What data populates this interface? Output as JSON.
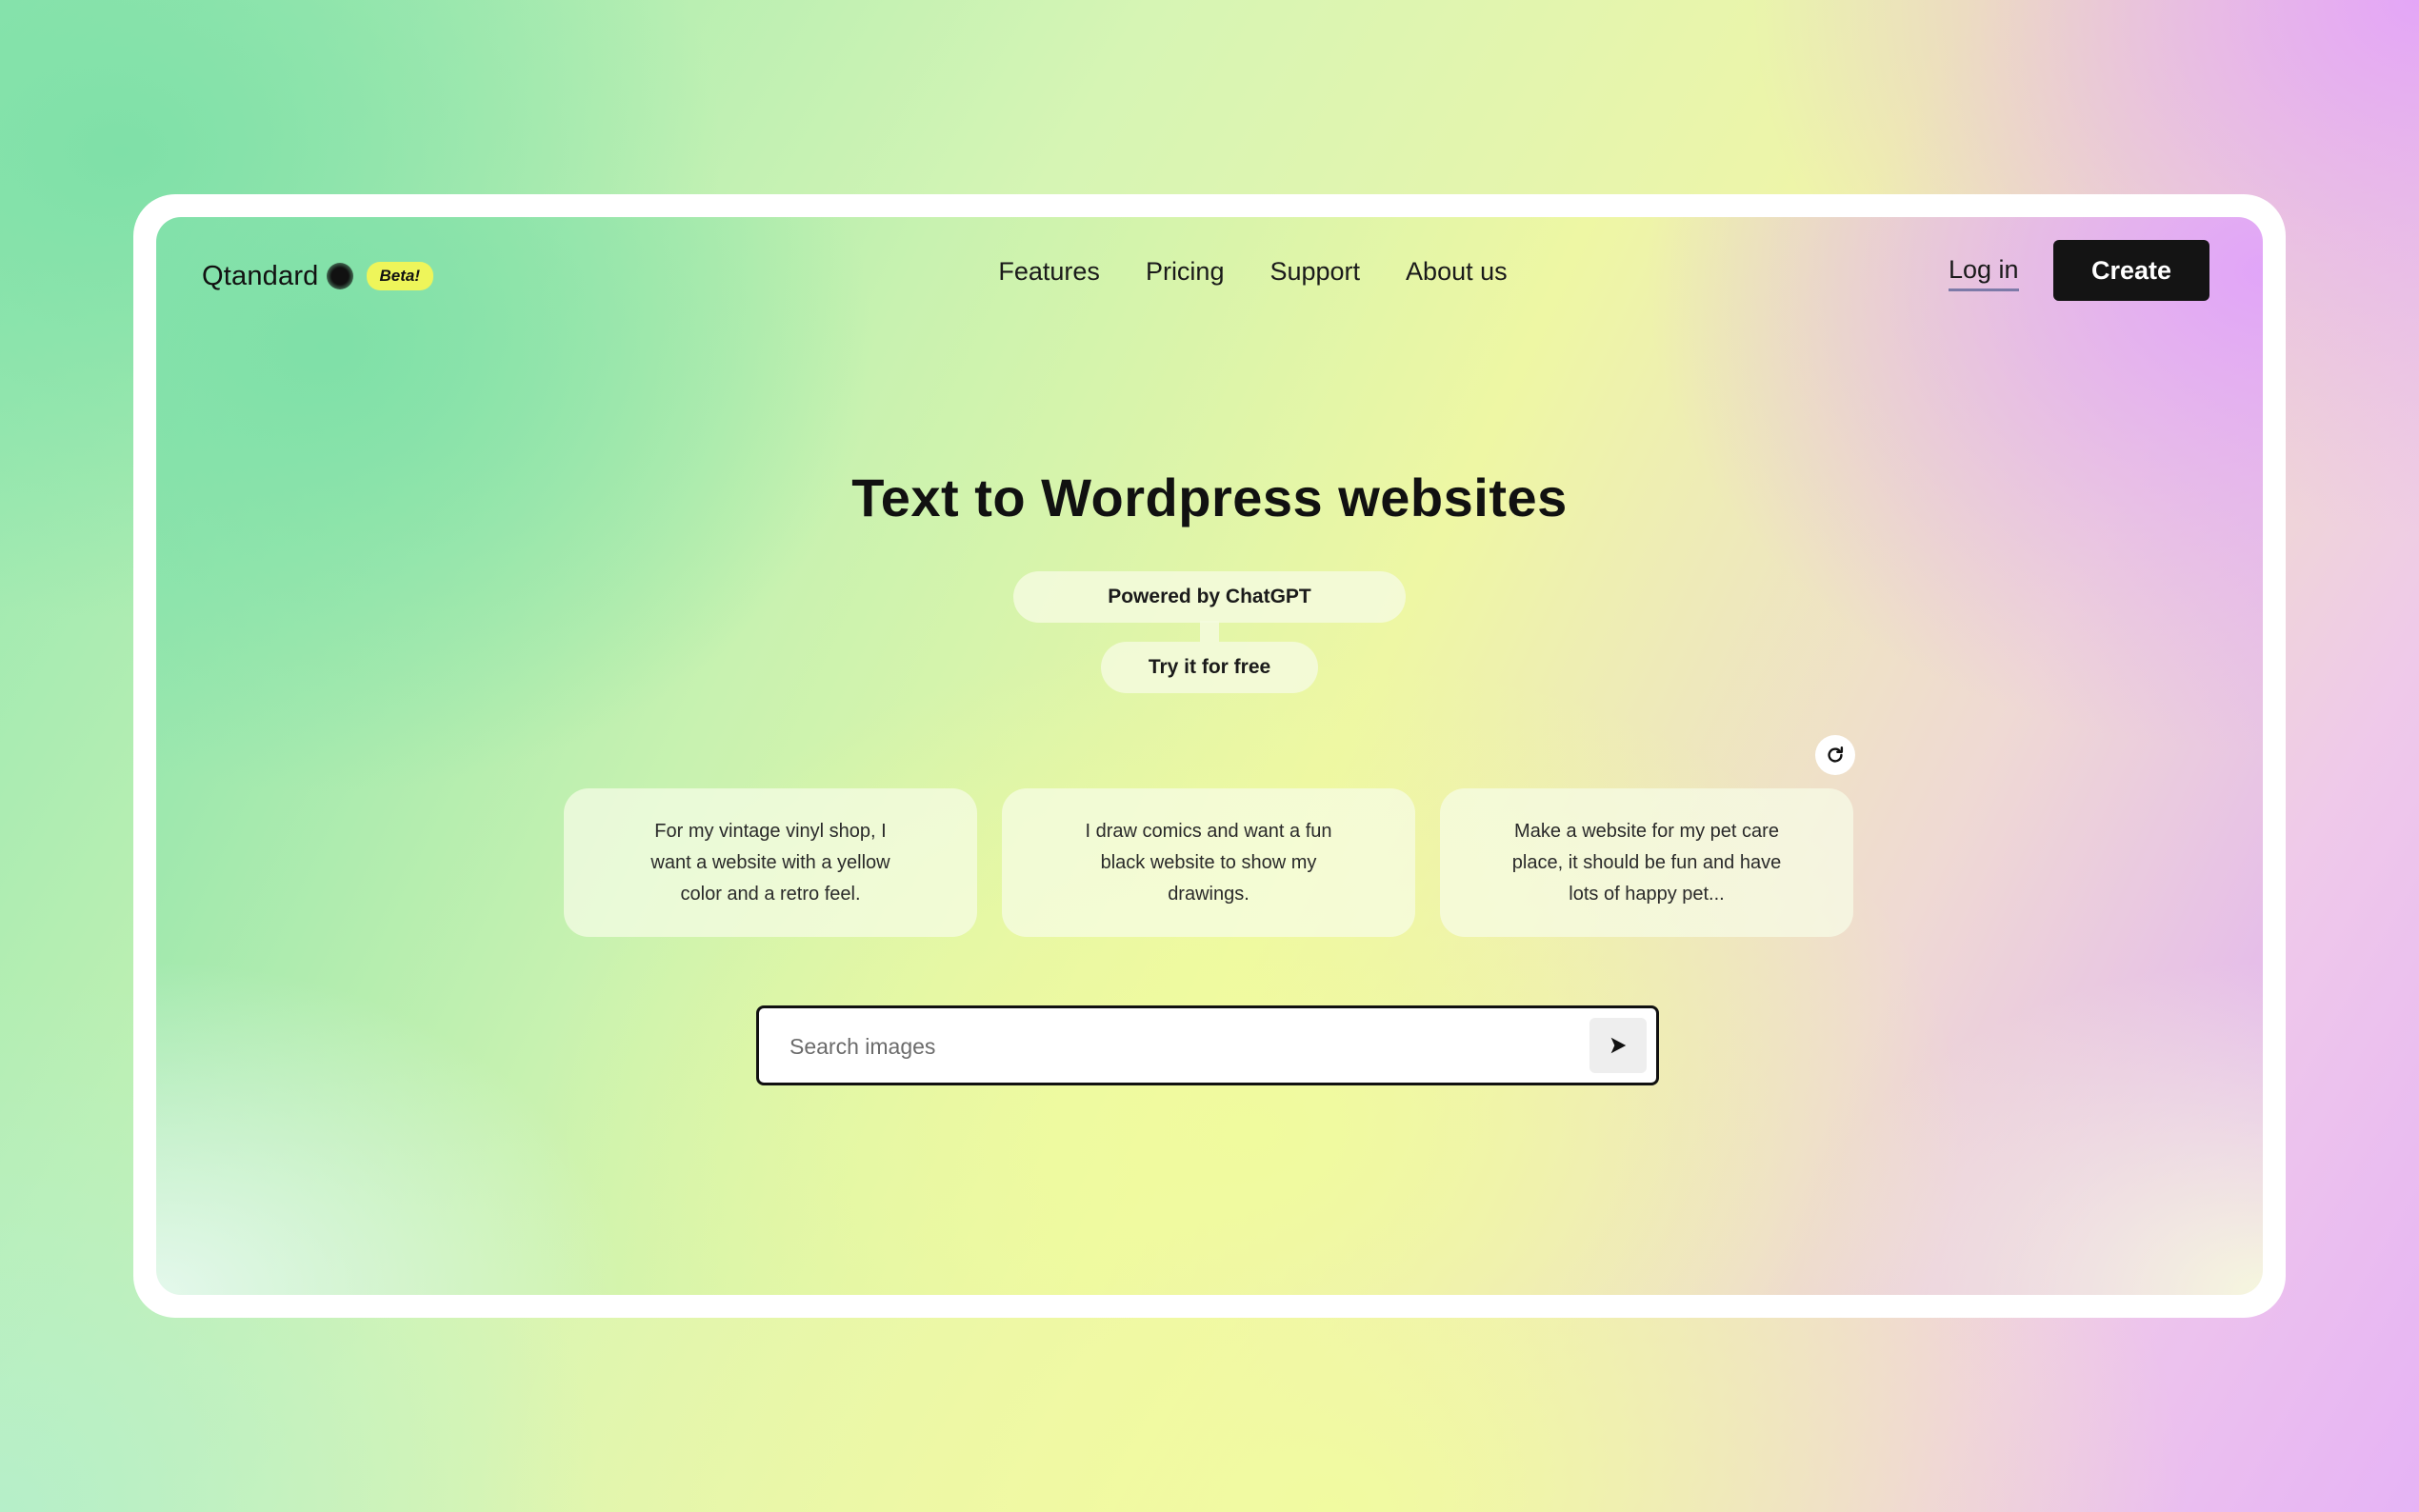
{
  "header": {
    "brand": "Qtandard",
    "badge": "Beta!",
    "nav": [
      "Features",
      "Pricing",
      "Support",
      "About us"
    ],
    "login_label": "Log in",
    "create_label": "Create"
  },
  "hero": {
    "title": "Text to Wordpress websites",
    "powered_by": "Powered by ChatGPT",
    "try_label": "Try it for free"
  },
  "suggestions": [
    "For my vintage vinyl shop, I want a website with a yellow color and a retro feel.",
    "I draw comics and want a fun black website to show my drawings.",
    "Make a website for my pet care place, it should be fun and have lots of happy pet..."
  ],
  "search": {
    "placeholder": "Search images",
    "value": ""
  },
  "icons": {
    "refresh": "refresh-icon",
    "submit": "send-arrow-icon"
  },
  "colors": {
    "badge": "#eef55a",
    "create_button": "#141414",
    "text": "#111111"
  }
}
